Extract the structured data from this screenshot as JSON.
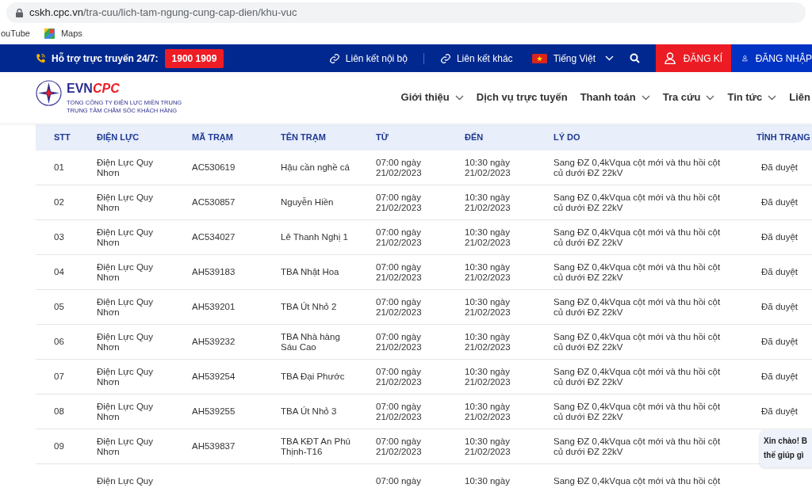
{
  "browser": {
    "url_host": "cskh.cpc.vn",
    "url_path": "/tra-cuu/lich-tam-ngung-cung-cap-dien/khu-vuc",
    "bookmarks": [
      {
        "label": "ouTube",
        "kind": "text"
      },
      {
        "label": "Maps",
        "kind": "maps"
      }
    ]
  },
  "topbar": {
    "hotline_label": "Hỗ trợ trực truyến 24/7:",
    "hotline_number": "1900 1909",
    "links": [
      "Liên kết nội bộ",
      "Liên kết khác"
    ],
    "language": "Tiếng Việt",
    "register": "ĐĂNG KÍ",
    "login": "ĐĂNG NHẬP"
  },
  "header": {
    "logo": {
      "brand_a": "EVN",
      "brand_b": "CPC",
      "line_1": "TỔNG CÔNG TY ĐIỆN LỰC MIỀN TRUNG",
      "line_2": "TRUNG TÂM CHĂM SÓC KHÁCH HÀNG"
    },
    "nav": [
      {
        "label": "Giới thiệu",
        "dropdown": true
      },
      {
        "label": "Dịch vụ trực tuyến",
        "dropdown": false
      },
      {
        "label": "Thanh toán",
        "dropdown": true
      },
      {
        "label": "Tra cứu",
        "dropdown": true
      },
      {
        "label": "Tin tức",
        "dropdown": true
      },
      {
        "label": "Liên",
        "dropdown": false
      }
    ]
  },
  "table": {
    "columns": [
      "STT",
      "ĐIỆN LỰC",
      "MÃ TRẠM",
      "TÊN TRẠM",
      "TỪ",
      "ĐẾN",
      "LÝ DO",
      "TÌNH TRẠNG"
    ],
    "rows": [
      {
        "stt": "01",
        "dien_luc": "Điện Lực Quy\nNhơn",
        "ma_tram": "AC530619",
        "ten_tram": "Hậu cần nghề cá",
        "tu": "07:00 ngày\n21/02/2023",
        "den": "10:30 ngày\n21/02/2023",
        "ly_do": "Sang ĐZ 0,4kVqua cột mới và thu hồi cột\ncủ dưới ĐZ 22kV",
        "tinh_trang": "Đã duyệt"
      },
      {
        "stt": "02",
        "dien_luc": "Điện Lực Quy\nNhơn",
        "ma_tram": "AC530857",
        "ten_tram": "Nguyễn Hiền",
        "tu": "07:00 ngày\n21/02/2023",
        "den": "10:30 ngày\n21/02/2023",
        "ly_do": "Sang ĐZ 0,4kVqua cột mới và thu hồi cột\ncủ dưới ĐZ 22kV",
        "tinh_trang": "Đã duyệt"
      },
      {
        "stt": "03",
        "dien_luc": "Điện Lực Quy\nNhơn",
        "ma_tram": "AC534027",
        "ten_tram": "Lê Thanh Nghị 1",
        "tu": "07:00 ngày\n21/02/2023",
        "den": "10:30 ngày\n21/02/2023",
        "ly_do": "Sang ĐZ 0,4kVqua cột mới và thu hồi cột\ncủ dưới ĐZ 22kV",
        "tinh_trang": "Đã duyệt"
      },
      {
        "stt": "04",
        "dien_luc": "Điện Lực Quy\nNhơn",
        "ma_tram": "AH539183",
        "ten_tram": "TBA Nhật Hoa",
        "tu": "07:00 ngày\n21/02/2023",
        "den": "10:30 ngày\n21/02/2023",
        "ly_do": "Sang ĐZ 0,4kVqua cột mới và thu hồi cột\ncủ dưới ĐZ 22kV",
        "tinh_trang": "Đã duyệt"
      },
      {
        "stt": "05",
        "dien_luc": "Điện Lực Quy\nNhơn",
        "ma_tram": "AH539201",
        "ten_tram": "TBA Út Nhỏ 2",
        "tu": "07:00 ngày\n21/02/2023",
        "den": "10:30 ngày\n21/02/2023",
        "ly_do": "Sang ĐZ 0,4kVqua cột mới và thu hồi cột\ncủ dưới ĐZ 22kV",
        "tinh_trang": "Đã duyệt"
      },
      {
        "stt": "06",
        "dien_luc": "Điện Lực Quy\nNhơn",
        "ma_tram": "AH539232",
        "ten_tram": "TBA Nhà hàng\nSáu Cao",
        "tu": "07:00 ngày\n21/02/2023",
        "den": "10:30 ngày\n21/02/2023",
        "ly_do": "Sang ĐZ 0,4kVqua cột mới và thu hồi cột\ncủ dưới ĐZ 22kV",
        "tinh_trang": "Đã duyệt"
      },
      {
        "stt": "07",
        "dien_luc": "Điện Lực Quy\nNhơn",
        "ma_tram": "AH539254",
        "ten_tram": "TBA Đại Phước",
        "tu": "07:00 ngày\n21/02/2023",
        "den": "10:30 ngày\n21/02/2023",
        "ly_do": "Sang ĐZ 0,4kVqua cột mới và thu hồi cột\ncủ dưới ĐZ 22kV",
        "tinh_trang": "Đã duyệt"
      },
      {
        "stt": "08",
        "dien_luc": "Điện Lực Quy\nNhơn",
        "ma_tram": "AH539255",
        "ten_tram": "TBA Út Nhỏ 3",
        "tu": "07:00 ngày\n21/02/2023",
        "den": "10:30 ngày\n21/02/2023",
        "ly_do": "Sang ĐZ 0,4kVqua cột mới và thu hồi cột\ncủ dưới ĐZ 22kV",
        "tinh_trang": "Đã duyệt"
      },
      {
        "stt": "09",
        "dien_luc": "Điện Lực Quy\nNhơn",
        "ma_tram": "AH539837",
        "ten_tram": "TBA KĐT An Phú\nThịnh-T16",
        "tu": "07:00 ngày\n21/02/2023",
        "den": "10:30 ngày\n21/02/2023",
        "ly_do": "Sang ĐZ 0,4kVqua cột mới và thu hồi cột\ncủ dưới ĐZ 22kV"
      },
      {
        "dien_luc": "Điện Lực Quy",
        "tu": "07:00 ngày",
        "den": "10:30 ngày",
        "ly_do": "Sang ĐZ 0,4kVqua cột mới và thu hồi cột"
      }
    ]
  },
  "chat": {
    "lines": [
      "Xin chào! B",
      "thế giúp gì"
    ]
  }
}
